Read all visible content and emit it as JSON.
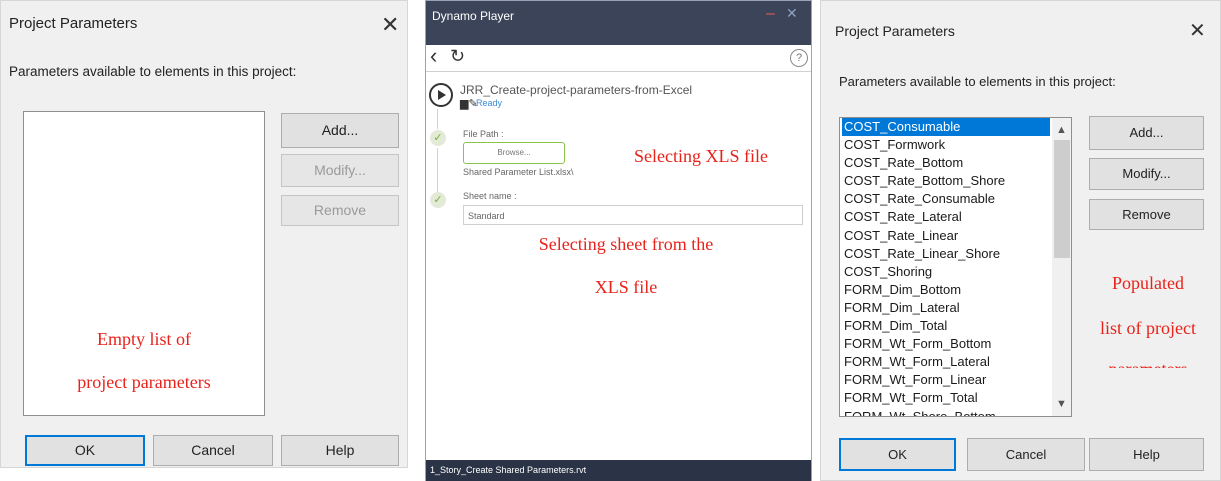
{
  "left_dialog": {
    "title": "Project Parameters",
    "close": "✕",
    "label": "Parameters available to elements in this project:",
    "buttons": {
      "add": "Add...",
      "modify": "Modify...",
      "remove": "Remove",
      "ok": "OK",
      "cancel": "Cancel",
      "help": "Help"
    },
    "annotation_line1": "Empty list of",
    "annotation_line2": "project parameters"
  },
  "dynamo": {
    "title": "Dynamo Player",
    "minimize": "–",
    "close": "✕",
    "back": "‹",
    "refresh": "↻",
    "help": "?",
    "script_name": "JRR_Create-project-parameters-from-Excel",
    "status": "Ready",
    "status_icons": "▆✎",
    "input1_label": "File Path :",
    "browse": "Browse...",
    "file_value": "Shared Parameter List.xlsx\\",
    "input2_label": "Sheet name :",
    "sheet_value": "Standard",
    "check": "✓",
    "footer": "1_Story_Create Shared Parameters.rvt",
    "annotation_xls": "Selecting XLS file",
    "annotation_sheet_line1": "Selecting sheet from the",
    "annotation_sheet_line2": "XLS file"
  },
  "right_dialog": {
    "title": "Project Parameters",
    "close": "✕",
    "label": "Parameters available to elements in this project:",
    "parameters": [
      "COST_Consumable",
      "COST_Formwork",
      "COST_Rate_Bottom",
      "COST_Rate_Bottom_Shore",
      "COST_Rate_Consumable",
      "COST_Rate_Lateral",
      "COST_Rate_Linear",
      "COST_Rate_Linear_Shore",
      "COST_Shoring",
      "FORM_Dim_Bottom",
      "FORM_Dim_Lateral",
      "FORM_Dim_Total",
      "FORM_Wt_Form_Bottom",
      "FORM_Wt_Form_Lateral",
      "FORM_Wt_Form_Linear",
      "FORM_Wt_Form_Total",
      "FORM_Wt_Shore_Bottom"
    ],
    "selected_index": 0,
    "scroll_up": "▲",
    "scroll_down": "▼",
    "buttons": {
      "add": "Add...",
      "modify": "Modify...",
      "remove": "Remove",
      "ok": "OK",
      "cancel": "Cancel",
      "help": "Help"
    },
    "annotation_line1": "Populated",
    "annotation_line2": "list of project",
    "annotation_line3": "parameters"
  },
  "colors": {
    "annotation": "#e8231b",
    "accent": "#0078d7",
    "dynamo_header": "#3b4458"
  }
}
